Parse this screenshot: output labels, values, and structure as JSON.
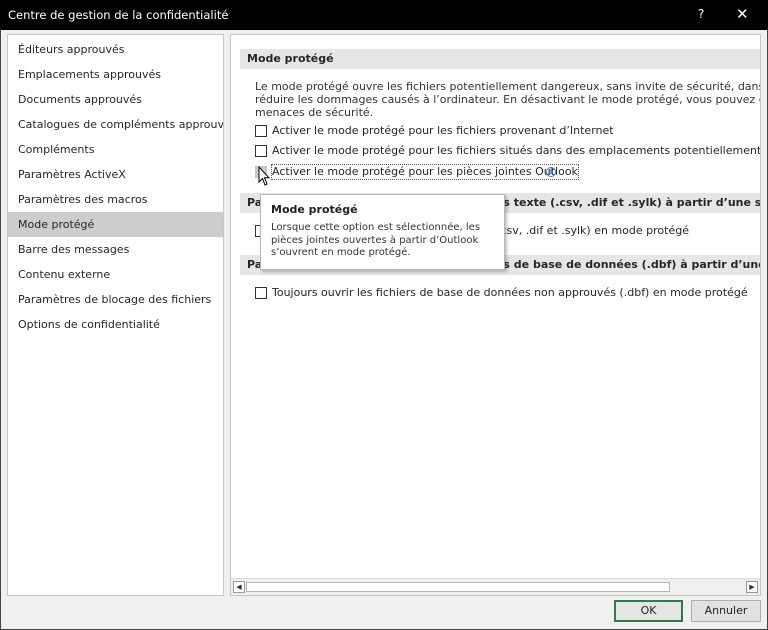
{
  "window": {
    "title": "Centre de gestion de la confidentialité",
    "help_label": "?",
    "close_label": "✕"
  },
  "sidebar": {
    "items": [
      {
        "label": "Éditeurs approuvés"
      },
      {
        "label": "Emplacements approuvés"
      },
      {
        "label": "Documents approuvés"
      },
      {
        "label": "Catalogues de compléments approuvés"
      },
      {
        "label": "Compléments"
      },
      {
        "label": "Paramètres ActiveX"
      },
      {
        "label": "Paramètres des macros"
      },
      {
        "label": "Mode protégé",
        "selected": true
      },
      {
        "label": "Barre des messages"
      },
      {
        "label": "Contenu externe"
      },
      {
        "label": "Paramètres de blocage des fichiers"
      },
      {
        "label": "Options de confidentialité"
      }
    ]
  },
  "main": {
    "protected_view": {
      "header": "Mode protégé",
      "description_lines": [
        "Le mode protégé ouvre les fichiers potentiellement dangereux, sans invite de sécurité, dans un mode res",
        "réduire les dommages causés à l’ordinateur. En désactivant le mode protégé, vous pouvez exposer l’ordi",
        "menaces de sécurité."
      ],
      "options": [
        {
          "label": "Activer le mode protégé pour les fichiers provenant d’Internet",
          "checked": false
        },
        {
          "label": "Activer le mode protégé pour les fichiers situés dans des emplacements potentiellement dangereux",
          "checked": false
        },
        {
          "label": "Activer le mode protégé pour les pièces jointes Outlook",
          "checked": false
        }
      ]
    },
    "text_files_section": {
      "header_prefix": "Pa",
      "header_suffix": "rs texte (.csv, .dif et .sylk) à partir d’une source no",
      "option_suffix": ".csv, .dif et .sylk) en mode protégé"
    },
    "dbf_section": {
      "header_prefix": "Pa",
      "header_suffix": "rs de base de données (.dbf) à partir d’une source",
      "option_label": "Toujours ouvrir les fichiers de base de données non approuvés (.dbf) en mode protégé",
      "checked": false
    }
  },
  "tooltip": {
    "title": "Mode protégé",
    "body_lines": [
      "Lorsque cette option est sélectionnée, les",
      "pièces jointes ouvertes à partir d’Outlook",
      "s’ouvrent en mode protégé."
    ]
  },
  "buttons": {
    "ok": "OK",
    "cancel": "Annuler"
  },
  "colors": {
    "titlebar": "#000000",
    "selected_item": "#cdcdcd",
    "section_header": "#e6e6e6",
    "ok_border": "#2f7a4f",
    "info_icon": "#2a7ad0"
  },
  "icons": [
    "help-icon",
    "close-icon",
    "info-icon",
    "scroll-left-icon",
    "scroll-right-icon",
    "mouse-pointer-icon"
  ]
}
